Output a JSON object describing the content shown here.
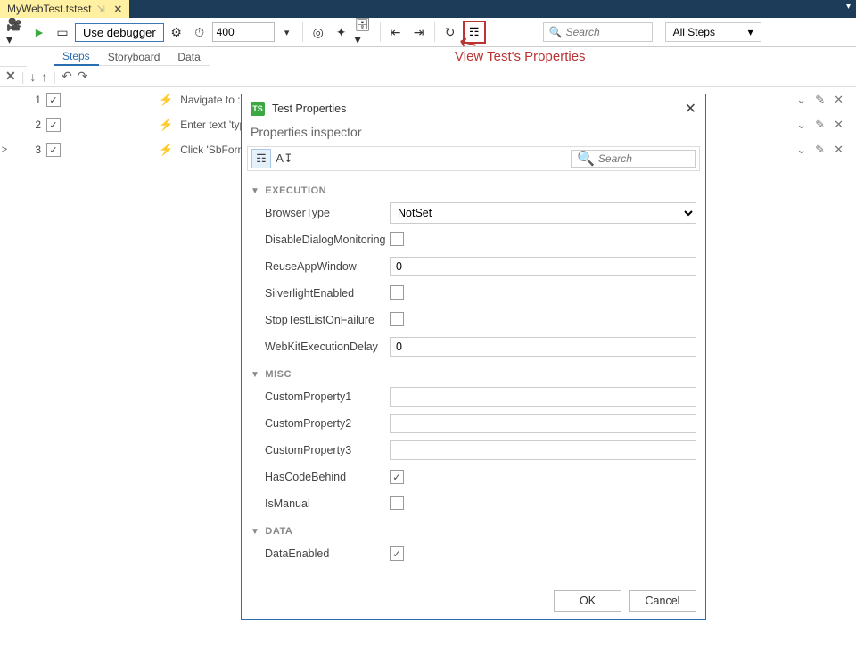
{
  "file_tab": {
    "name": "MyWebTest.tstest",
    "pin": "⇲",
    "close": "✕"
  },
  "toolbar": {
    "debugger_label": "Use debugger",
    "ms_value": "400",
    "search_placeholder": "Search",
    "all_steps_label": "All Steps"
  },
  "subtabs": {
    "steps": "Steps",
    "storyboard": "Storyboard",
    "data": "Data"
  },
  "steps": [
    {
      "num": "1",
      "text": "Navigate to :"
    },
    {
      "num": "2",
      "text": "Enter text 'typ"
    },
    {
      "num": "3",
      "text": "Click 'SbForm"
    }
  ],
  "annotation": "View Test's Properties",
  "dialog": {
    "title": "Test Properties",
    "badge": "TS",
    "subtitle": "Properties inspector",
    "search_placeholder": "Search",
    "categories": {
      "execution": "EXECUTION",
      "misc": "MISC",
      "data": "DATA"
    },
    "props": {
      "BrowserType": {
        "label": "BrowserType",
        "value": "NotSet"
      },
      "DisableDialogMonitoring": {
        "label": "DisableDialogMonitoring",
        "checked": false
      },
      "ReuseAppWindow": {
        "label": "ReuseAppWindow",
        "value": "0"
      },
      "SilverlightEnabled": {
        "label": "SilverlightEnabled",
        "checked": false
      },
      "StopTestListOnFailure": {
        "label": "StopTestListOnFailure",
        "checked": false
      },
      "WebKitExecutionDelay": {
        "label": "WebKitExecutionDelay",
        "value": "0"
      },
      "CustomProperty1": {
        "label": "CustomProperty1",
        "value": ""
      },
      "CustomProperty2": {
        "label": "CustomProperty2",
        "value": ""
      },
      "CustomProperty3": {
        "label": "CustomProperty3",
        "value": ""
      },
      "HasCodeBehind": {
        "label": "HasCodeBehind",
        "checked": true
      },
      "IsManual": {
        "label": "IsManual",
        "checked": false
      },
      "DataEnabled": {
        "label": "DataEnabled",
        "checked": true
      }
    },
    "buttons": {
      "ok": "OK",
      "cancel": "Cancel"
    }
  }
}
